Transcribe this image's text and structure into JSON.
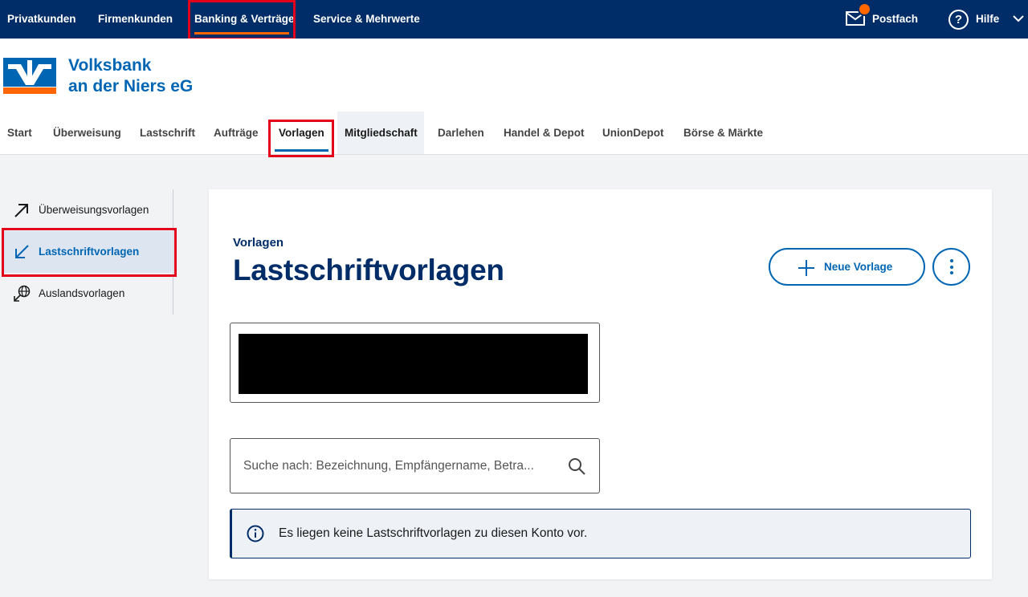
{
  "topnav": {
    "items": [
      "Privatkunden",
      "Firmenkunden",
      "Banking & Verträge",
      "Service & Mehrwerte"
    ],
    "postfach": "Postfach",
    "hilfe": "Hilfe"
  },
  "bank": {
    "line1": "Volksbank",
    "line2": "an der Niers eG"
  },
  "subnav": {
    "items": [
      "Start",
      "Überweisung",
      "Lastschrift",
      "Aufträge",
      "Vorlagen",
      "Mitgliedschaft",
      "Darlehen",
      "Handel & Depot",
      "UnionDepot",
      "Börse & Märkte"
    ]
  },
  "sidebar": {
    "items": [
      {
        "label": "Überweisungsvorlagen",
        "icon": "arrow-up-right-icon"
      },
      {
        "label": "Lastschriftvorlagen",
        "icon": "arrow-down-left-icon"
      },
      {
        "label": "Auslandsvorlagen",
        "icon": "globe-transfer-icon"
      }
    ]
  },
  "main": {
    "overline": "Vorlagen",
    "title": "Lastschriftvorlagen",
    "new_button": "Neue Vorlage",
    "search_placeholder": "Suche nach: Bezeichnung, Empfängername, Betra...",
    "info_text": "Es liegen keine Lastschriftvorlagen zu diesen Konto vor."
  },
  "colors": {
    "topbar": "#002d67",
    "accent": "#0066b3",
    "highlight": "#e3001b",
    "orange": "#ff6600"
  }
}
